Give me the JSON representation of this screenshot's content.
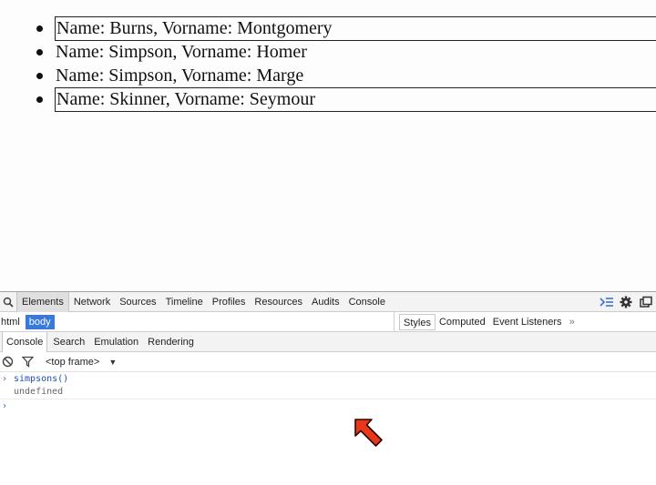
{
  "page": {
    "items": [
      {
        "text": "Name: Burns, Vorname: Montgomery",
        "boxed": true
      },
      {
        "text": "Name: Simpson, Vorname: Homer",
        "boxed": false
      },
      {
        "text": "Name: Simpson, Vorname: Marge",
        "boxed": false
      },
      {
        "text": "Name: Skinner, Vorname: Seymour",
        "boxed": true
      }
    ]
  },
  "devtools": {
    "main_tabs": [
      "Elements",
      "Network",
      "Sources",
      "Timeline",
      "Profiles",
      "Resources",
      "Audits",
      "Console"
    ],
    "selected_tab": "Elements",
    "breadcrumbs": [
      "html",
      "body"
    ],
    "selected_crumb": "body",
    "side_tabs": [
      "Styles",
      "Computed",
      "Event Listeners"
    ],
    "side_more": "»",
    "drawer_tabs": [
      "Console",
      "Search",
      "Emulation",
      "Rendering"
    ],
    "frame_selector": "<top frame>",
    "console": {
      "input": "simpsons()",
      "result": "undefined"
    },
    "colors": {
      "selected_crumb": "#3879d9",
      "console_input": "#1a4fbf",
      "cursor": "#e8371a"
    }
  }
}
